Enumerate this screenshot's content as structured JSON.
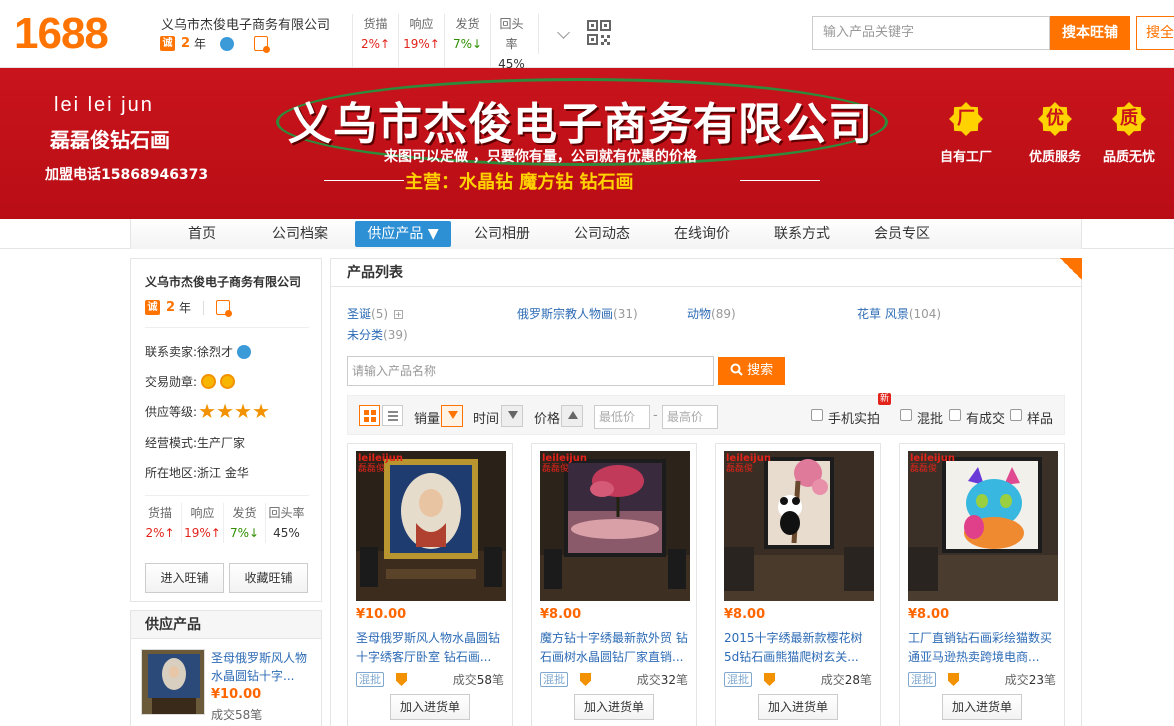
{
  "header": {
    "logo": "1688",
    "company_name": "义乌市杰俊电子商务有限公司",
    "cheng": "诚",
    "years": "2",
    "years_unit": "年",
    "stats": [
      {
        "label": "货描",
        "value": "2%↑"
      },
      {
        "label": "响应",
        "value": "19%↑"
      },
      {
        "label": "发货",
        "value": "7%↓"
      },
      {
        "label": "回头率",
        "value": "45%"
      }
    ],
    "search_placeholder": "输入产品关键字",
    "search_shop_label": "搜本旺铺",
    "search_all_label": "搜全"
  },
  "banner": {
    "en_name": "lei lei jun",
    "cn_name": "磊磊俊钻石画",
    "phone": "加盟电话15868946373",
    "title": "义乌市杰俊电子商务有限公司",
    "subtitle": "来图可以定做 ，只要你有量，公司就有优惠的价格",
    "main_products": "主营：水晶钻  魔方钻  钻石画",
    "features": [
      {
        "badge": "厂",
        "label": "自有工厂"
      },
      {
        "badge": "优",
        "label": "优质服务"
      },
      {
        "badge": "质",
        "label": "品质无忧"
      }
    ],
    "colors": {
      "background": "#c9141c",
      "ellipse": "#2e8b3c",
      "highlight": "#ffd200"
    }
  },
  "nav": {
    "items": [
      "首页",
      "公司档案",
      "供应产品 ▼",
      "公司相册",
      "公司动态",
      "在线询价",
      "联系方式",
      "会员专区"
    ],
    "active_index": 2
  },
  "sidebar": {
    "company_name": "义乌市杰俊电子商务有限公司",
    "cheng": "诚",
    "years": "2",
    "years_unit": "年",
    "contact": "联系卖家:徐烈才",
    "medals_label": "交易勋章:",
    "level_label": "供应等级:",
    "level_stars": 4,
    "business_mode": "经营模式:生产厂家",
    "region": "所在地区:浙江 金华",
    "stats": [
      {
        "label": "货描",
        "value": "2%↑"
      },
      {
        "label": "响应",
        "value": "19%↑"
      },
      {
        "label": "发货",
        "value": "7%↓"
      },
      {
        "label": "回头率",
        "value": "45%"
      }
    ],
    "enter_shop_label": "进入旺铺",
    "favorite_shop_label": "收藏旺铺",
    "supply_title": "供应产品",
    "supply_item": {
      "title": "圣母俄罗斯风人物水晶圆钻十字...",
      "price": "¥10.00",
      "deal": "成交58笔"
    }
  },
  "products": {
    "section_title": "产品列表",
    "categories": [
      {
        "name": "圣诞",
        "count": "(5)"
      },
      {
        "name": "俄罗斯宗教人物画",
        "count": "(31)"
      },
      {
        "name": "动物",
        "count": "(89)"
      },
      {
        "name": "花草 风景",
        "count": "(104)"
      },
      {
        "name": "未分类",
        "count": "(39)"
      }
    ],
    "search_placeholder": "请输入产品名称",
    "search_button": "搜索",
    "filter": {
      "sales_label": "销量",
      "time_label": "时间",
      "price_label": "价格",
      "price_min_placeholder": "最低价",
      "price_max_placeholder": "最高价",
      "new_tag": "新",
      "checkboxes": [
        "手机实拍",
        "混批",
        "有成交",
        "样品"
      ]
    },
    "tag_pifa": "混批",
    "add_button": "加入进货单",
    "deal_prefix": "成交",
    "deal_suffix": "笔",
    "items": [
      {
        "brand": "leileijun",
        "brand_cn": "磊磊俊",
        "price": "¥10.00",
        "title": "圣母俄罗斯风人物水晶圆钻十字绣客厅卧室 钻石画...",
        "deals": "58"
      },
      {
        "brand": "leileijun",
        "brand_cn": "磊磊俊",
        "price": "¥8.00",
        "title": "魔方钻十字绣最新款外贸 钻石画树水晶圆钻厂家直销...",
        "deals": "32"
      },
      {
        "brand": "leileijun",
        "brand_cn": "磊磊俊",
        "price": "¥8.00",
        "title": "2015十字绣最新款樱花树5d钻石画熊猫爬树玄关...",
        "deals": "28"
      },
      {
        "brand": "leileijun",
        "brand_cn": "磊磊俊",
        "price": "¥8.00",
        "title": "工厂直销钻石画彩绘猫数买通亚马逊热卖跨境电商...",
        "deals": "23"
      }
    ]
  }
}
